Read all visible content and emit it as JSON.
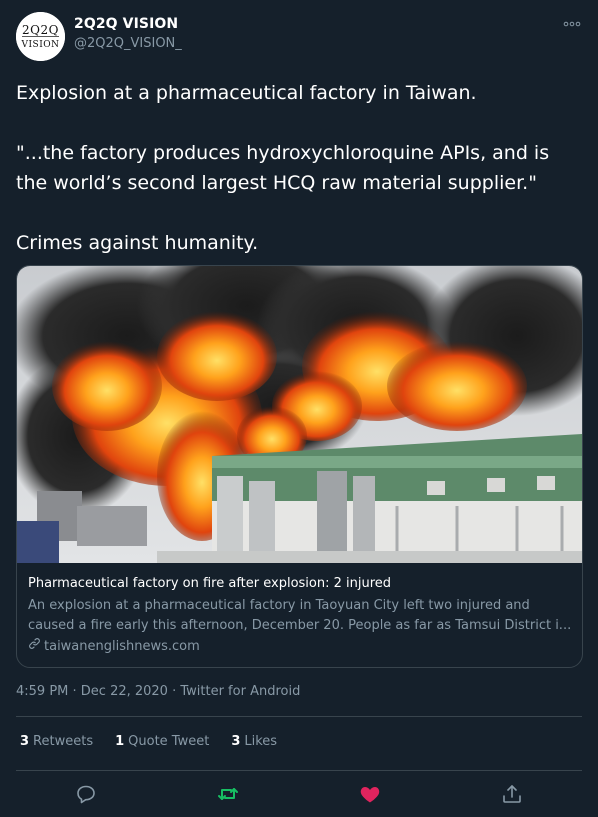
{
  "user": {
    "name": "2Q2Q VISION",
    "handle": "@2Q2Q_VISION_",
    "avatar_text": "2Q2Q VISION"
  },
  "tweet": {
    "line1": "Explosion at a pharmaceutical factory in Taiwan.",
    "line2": "\"...the factory produces hydroxychloroquine APIs, and is the world’s second largest HCQ raw material supplier.\"",
    "line3": "Crimes against humanity."
  },
  "card": {
    "title": "Pharmaceutical factory on fire after explosion: 2 injured",
    "desc_line1": "An explosion at a pharmaceutical factory in Taoyuan City left two injured and",
    "desc_line2": "caused a fire early this afternoon, December 20. People as far as Tamsui District i...",
    "domain": "taiwanenglishnews.com"
  },
  "meta": {
    "time": "4:59 PM · Dec 22, 2020 · Twitter for Android"
  },
  "stats": {
    "retweets_count": "3",
    "retweets_label": "Retweets",
    "quotes_count": "1",
    "quotes_label": "Quote Tweet",
    "likes_count": "3",
    "likes_label": "Likes"
  },
  "colors": {
    "background": "#15202b",
    "secondary_text": "#8899a6",
    "border": "#38444d",
    "retweet_green": "#17bf63",
    "like_pink": "#e0245e"
  },
  "icons": {
    "more": "more-icon",
    "link": "link-icon",
    "reply": "reply-icon",
    "retweet": "retweet-icon",
    "like": "like-icon",
    "share": "share-icon"
  }
}
